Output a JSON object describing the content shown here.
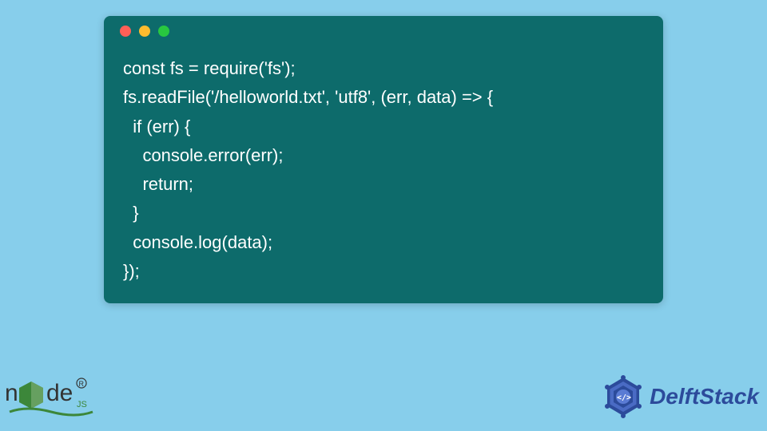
{
  "window": {
    "traffic_lights": [
      "red",
      "yellow",
      "green"
    ]
  },
  "code": {
    "lines": [
      "const fs = require('fs');",
      "fs.readFile('/helloworld.txt', 'utf8', (err, data) => {",
      "  if (err) {",
      "    console.error(err);",
      "    return;",
      "  }",
      "  console.log(data);",
      "});"
    ]
  },
  "branding": {
    "left_logo": "node.js",
    "right_logo_text": "DelftStack"
  },
  "colors": {
    "page_bg": "#87ceeb",
    "code_bg": "#0d6b6b",
    "code_fg": "#ffffff",
    "brand_blue": "#2c4b9b",
    "node_green": "#3c873a"
  }
}
